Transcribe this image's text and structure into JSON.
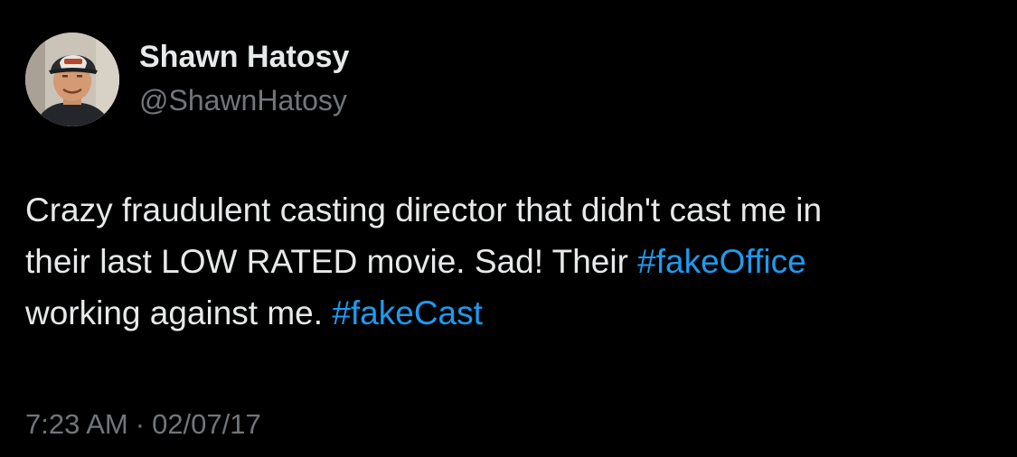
{
  "author": {
    "display_name": "Shawn Hatosy",
    "handle": "@ShawnHatosy",
    "avatar_icon": "profile-photo-icon"
  },
  "tweet": {
    "line1": "Crazy fraudulent casting director that didn't cast me in",
    "line2_text": "their last LOW RATED movie. Sad! Their ",
    "line2_hashtag": "#fakeOffice",
    "line3_text": "working against me. ",
    "line3_hashtag": "#fakeCast"
  },
  "meta": {
    "time": "7:23 AM",
    "separator": "·",
    "date": "02/07/17"
  },
  "colors": {
    "background": "#000000",
    "text": "#e7e9ea",
    "secondary": "#71767b",
    "link": "#1d9bf0"
  }
}
